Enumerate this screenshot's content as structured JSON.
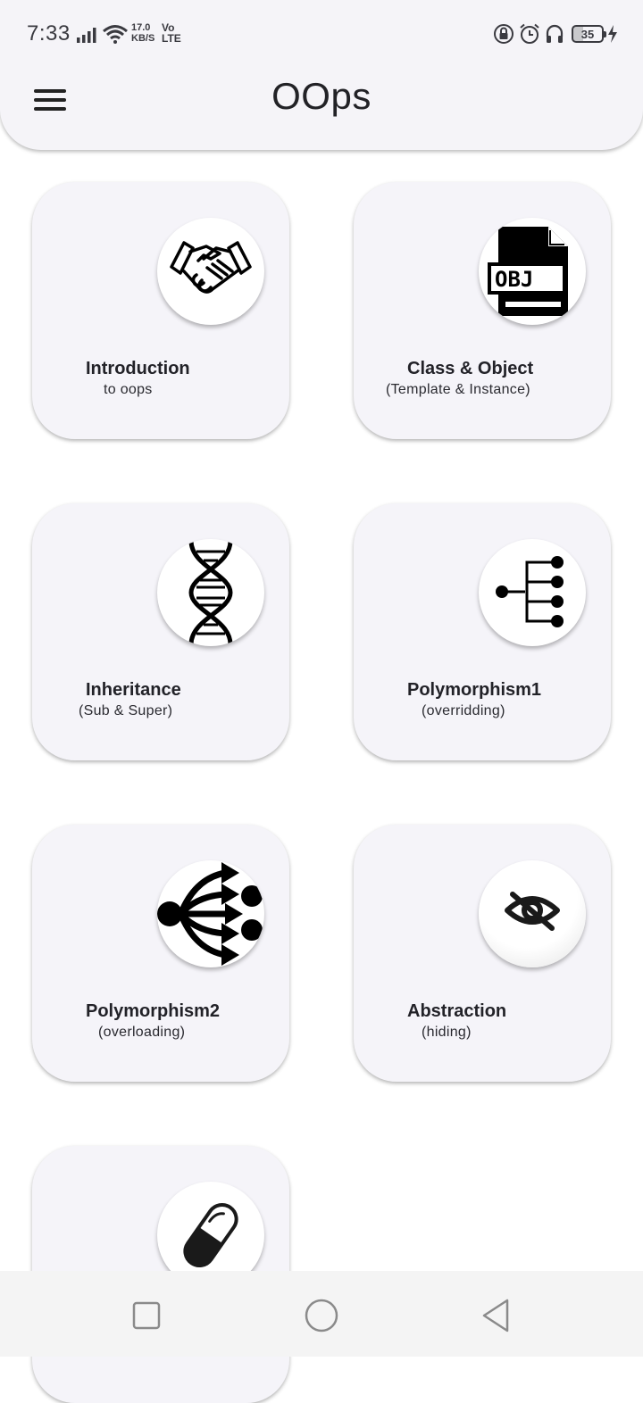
{
  "status_bar": {
    "time": "7:33",
    "net_speed_value": "17.0",
    "net_speed_unit": "KB/S",
    "volte_top": "Vo",
    "volte_bottom": "LTE",
    "battery": "35"
  },
  "app_bar": {
    "title": "OOps",
    "menu_icon": "hamburger-menu-icon"
  },
  "cards": [
    {
      "title": "Introduction",
      "subtitle": "to oops",
      "icon": "handshake-icon"
    },
    {
      "title": "Class & Object",
      "subtitle": "(Template & Instance)",
      "icon": "obj-file-icon"
    },
    {
      "title": "Inheritance",
      "subtitle": "(Sub & Super)",
      "icon": "dna-icon"
    },
    {
      "title": "Polymorphism1",
      "subtitle": "(overridding)",
      "icon": "tree-structure-icon"
    },
    {
      "title": "Polymorphism2",
      "subtitle": "(overloading)",
      "icon": "branching-arrows-icon"
    },
    {
      "title": "Abstraction",
      "subtitle": "(hiding)",
      "icon": "eye-off-icon"
    },
    {
      "title": "",
      "subtitle": "",
      "icon": "capsule-icon"
    }
  ],
  "nav_bar": {
    "recents_icon": "square-recents-icon",
    "home_icon": "circle-home-icon",
    "back_icon": "triangle-back-icon"
  },
  "colors": {
    "card_background": "#f5f4f9",
    "app_bar_background": "#f5f4f8",
    "text": "#222228"
  }
}
